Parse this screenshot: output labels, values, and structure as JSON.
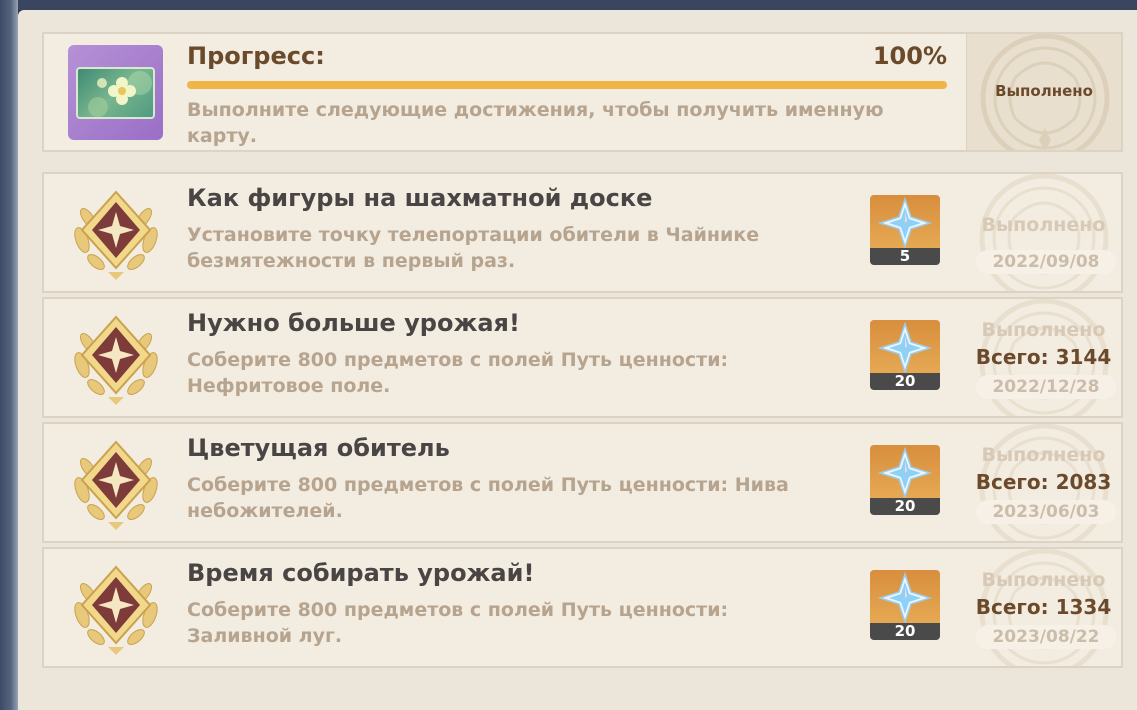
{
  "summary": {
    "title": "Прогресс:",
    "percent_text": "100%",
    "progress": 1.0,
    "description": "Выполните следующие достижения, чтобы получить именную карту.",
    "status": "Выполнено",
    "namecard_icon": "namecard-flower-icon"
  },
  "achievements": [
    {
      "title": "Как фигуры на шахматной доске",
      "description": "Установите точку телепортации обители в Чайнике безмятежности в первый раз.",
      "reward": "5",
      "reward_icon": "primogem-icon",
      "status": "Выполнено",
      "total": "",
      "date": "2022/09/08"
    },
    {
      "title": "Нужно больше урожая!",
      "description": "Соберите 800 предметов с полей Путь ценности: Нефритовое поле.",
      "reward": "20",
      "reward_icon": "primogem-icon",
      "status": "Выполнено",
      "total": "Всего: 3144",
      "date": "2022/12/28"
    },
    {
      "title": "Цветущая обитель",
      "description": "Соберите 800 предметов с полей Путь ценности: Нива небожителей.",
      "reward": "20",
      "reward_icon": "primogem-icon",
      "status": "Выполнено",
      "total": "Всего: 2083",
      "date": "2023/06/03"
    },
    {
      "title": "Время собирать урожай!",
      "description": "Соберите 800 предметов с полей Путь ценности: Заливной луг.",
      "reward": "20",
      "reward_icon": "primogem-icon",
      "status": "Выполнено",
      "total": "Всего: 1334",
      "date": "2023/08/22"
    }
  ],
  "colors": {
    "panel_bg": "#ece5da",
    "card_bg": "#f3ece1",
    "progress_fill": "#f0b547",
    "title_brown": "#6b4a2c",
    "desc_tan": "#b6a48f"
  }
}
